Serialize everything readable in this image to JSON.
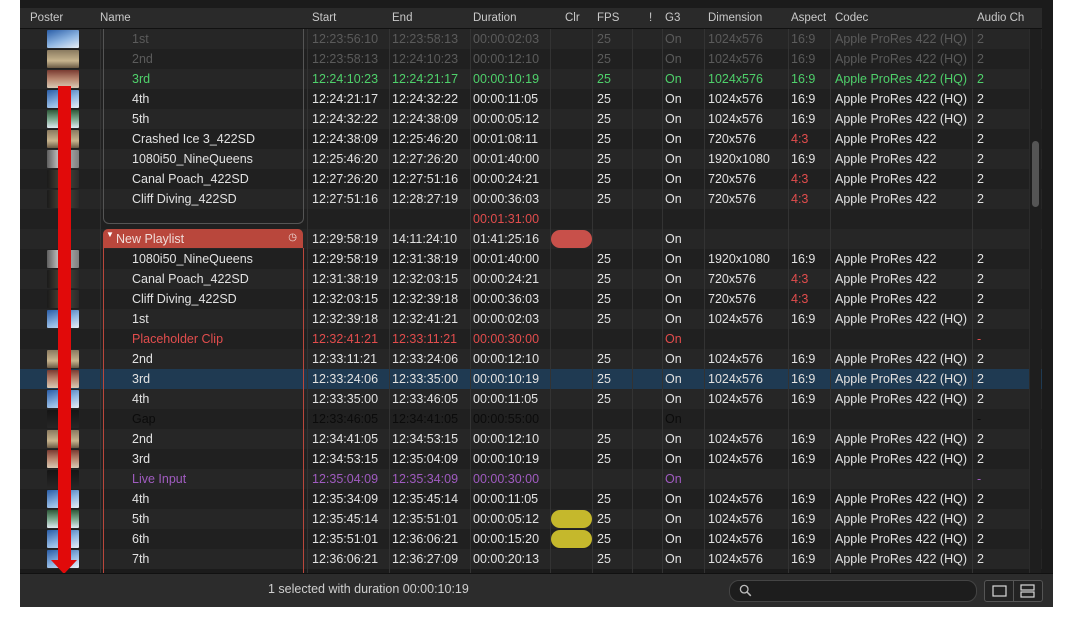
{
  "columns": [
    {
      "key": "poster",
      "label": "Poster"
    },
    {
      "key": "name",
      "label": "Name"
    },
    {
      "key": "start",
      "label": "Start"
    },
    {
      "key": "end",
      "label": "End"
    },
    {
      "key": "duration",
      "label": "Duration"
    },
    {
      "key": "clr",
      "label": "Clr"
    },
    {
      "key": "fps",
      "label": "FPS"
    },
    {
      "key": "bang",
      "label": "!"
    },
    {
      "key": "g3",
      "label": "G3"
    },
    {
      "key": "dimension",
      "label": "Dimension"
    },
    {
      "key": "aspect",
      "label": "Aspect"
    },
    {
      "key": "codec",
      "label": "Codec"
    },
    {
      "key": "audio",
      "label": "Audio Ch"
    }
  ],
  "colors": {
    "selected": "#1f3a52",
    "green": "#4fd16b",
    "red": "#e14d4d",
    "purple": "#a05cc0",
    "playlist": "#b9473c",
    "pill_yellow": "#c5b82c",
    "arrow": "#e10a0a"
  },
  "rows": [
    {
      "poster": "blue",
      "name": "1st",
      "start": "12:23:56:10",
      "end": "12:23:58:13",
      "duration": "00:00:02:03",
      "fps": "25",
      "g3": "On",
      "dimension": "1024x576",
      "aspect": "16:9",
      "codec": "Apple ProRes 422 (HQ)",
      "audio": "2",
      "style": "dim"
    },
    {
      "poster": "tan",
      "name": "2nd",
      "start": "12:23:58:13",
      "end": "12:24:10:23",
      "duration": "00:00:12:10",
      "fps": "25",
      "g3": "On",
      "dimension": "1024x576",
      "aspect": "16:9",
      "codec": "Apple ProRes 422 (HQ)",
      "audio": "2",
      "style": "dim"
    },
    {
      "poster": "brown",
      "name": "3rd",
      "start": "12:24:10:23",
      "end": "12:24:21:17",
      "duration": "00:00:10:19",
      "fps": "25",
      "g3": "On",
      "dimension": "1024x576",
      "aspect": "16:9",
      "codec": "Apple ProRes 422 (HQ)",
      "audio": "2",
      "style": "green"
    },
    {
      "poster": "blue",
      "name": "4th",
      "start": "12:24:21:17",
      "end": "12:24:32:22",
      "duration": "00:00:11:05",
      "fps": "25",
      "g3": "On",
      "dimension": "1024x576",
      "aspect": "16:9",
      "codec": "Apple ProRes 422 (HQ)",
      "audio": "2"
    },
    {
      "poster": "green",
      "name": "5th",
      "start": "12:24:32:22",
      "end": "12:24:38:09",
      "duration": "00:00:05:12",
      "fps": "25",
      "g3": "On",
      "dimension": "1024x576",
      "aspect": "16:9",
      "codec": "Apple ProRes 422 (HQ)",
      "audio": "2"
    },
    {
      "poster": "tan",
      "name": "Crashed Ice 3_422SD",
      "start": "12:24:38:09",
      "end": "12:25:46:20",
      "duration": "00:01:08:11",
      "fps": "25",
      "g3": "On",
      "dimension": "720x576",
      "aspect": "4:3",
      "codec": "Apple ProRes 422",
      "audio": "2",
      "aspect_red": true
    },
    {
      "poster": "gray",
      "name": "1080i50_NineQueens",
      "start": "12:25:46:20",
      "end": "12:27:26:20",
      "duration": "00:01:40:00",
      "fps": "25",
      "g3": "On",
      "dimension": "1920x1080",
      "aspect": "16:9",
      "codec": "Apple ProRes 422",
      "audio": "2"
    },
    {
      "poster": "dark",
      "name": "Canal Poach_422SD",
      "start": "12:27:26:20",
      "end": "12:27:51:16",
      "duration": "00:00:24:21",
      "fps": "25",
      "g3": "On",
      "dimension": "720x576",
      "aspect": "4:3",
      "codec": "Apple ProRes 422",
      "audio": "2",
      "aspect_red": true
    },
    {
      "poster": "dark",
      "name": "Cliff Diving_422SD",
      "start": "12:27:51:16",
      "end": "12:28:27:19",
      "duration": "00:00:36:03",
      "fps": "25",
      "g3": "On",
      "dimension": "720x576",
      "aspect": "4:3",
      "codec": "Apple ProRes 422",
      "audio": "2",
      "aspect_red": true
    },
    {
      "poster": "",
      "name": "",
      "start": "",
      "end": "",
      "duration": "00:01:31:00",
      "fps": "",
      "g3": "",
      "dimension": "",
      "aspect": "",
      "codec": "",
      "audio": "",
      "duration_red": true
    },
    {
      "poster": "",
      "name": "New Playlist",
      "start": "12:29:58:19",
      "end": "14:11:24:10",
      "duration": "01:41:25:16",
      "fps": "",
      "g3": "On",
      "dimension": "",
      "aspect": "",
      "codec": "",
      "audio": "",
      "playlist": true,
      "pill": "red"
    },
    {
      "poster": "gray",
      "name": "1080i50_NineQueens",
      "start": "12:29:58:19",
      "end": "12:31:38:19",
      "duration": "00:01:40:00",
      "fps": "25",
      "g3": "On",
      "dimension": "1920x1080",
      "aspect": "16:9",
      "codec": "Apple ProRes 422",
      "audio": "2"
    },
    {
      "poster": "dark",
      "name": "Canal Poach_422SD",
      "start": "12:31:38:19",
      "end": "12:32:03:15",
      "duration": "00:00:24:21",
      "fps": "25",
      "g3": "On",
      "dimension": "720x576",
      "aspect": "4:3",
      "codec": "Apple ProRes 422",
      "audio": "2",
      "aspect_red": true
    },
    {
      "poster": "dark",
      "name": "Cliff Diving_422SD",
      "start": "12:32:03:15",
      "end": "12:32:39:18",
      "duration": "00:00:36:03",
      "fps": "25",
      "g3": "On",
      "dimension": "720x576",
      "aspect": "4:3",
      "codec": "Apple ProRes 422",
      "audio": "2",
      "aspect_red": true
    },
    {
      "poster": "blue",
      "name": "1st",
      "start": "12:32:39:18",
      "end": "12:32:41:21",
      "duration": "00:00:02:03",
      "fps": "25",
      "g3": "On",
      "dimension": "1024x576",
      "aspect": "16:9",
      "codec": "Apple ProRes 422 (HQ)",
      "audio": "2"
    },
    {
      "poster": "",
      "name": "Placeholder Clip",
      "start": "12:32:41:21",
      "end": "12:33:11:21",
      "duration": "00:00:30:00",
      "fps": "",
      "g3": "On",
      "dimension": "",
      "aspect": "",
      "codec": "",
      "audio": "-",
      "style": "red"
    },
    {
      "poster": "tan",
      "name": "2nd",
      "start": "12:33:11:21",
      "end": "12:33:24:06",
      "duration": "00:00:12:10",
      "fps": "25",
      "g3": "On",
      "dimension": "1024x576",
      "aspect": "16:9",
      "codec": "Apple ProRes 422 (HQ)",
      "audio": "2"
    },
    {
      "poster": "brown",
      "name": "3rd",
      "start": "12:33:24:06",
      "end": "12:33:35:00",
      "duration": "00:00:10:19",
      "fps": "25",
      "g3": "On",
      "dimension": "1024x576",
      "aspect": "16:9",
      "codec": "Apple ProRes 422 (HQ)",
      "audio": "2",
      "selected": true
    },
    {
      "poster": "blue",
      "name": "4th",
      "start": "12:33:35:00",
      "end": "12:33:46:05",
      "duration": "00:00:11:05",
      "fps": "25",
      "g3": "On",
      "dimension": "1024x576",
      "aspect": "16:9",
      "codec": "Apple ProRes 422 (HQ)",
      "audio": "2"
    },
    {
      "poster": "black",
      "name": "Gap",
      "start": "12:33:46:05",
      "end": "12:34:41:05",
      "duration": "00:00:55:00",
      "fps": "",
      "g3": "On",
      "dimension": "",
      "aspect": "",
      "codec": "",
      "audio": "-",
      "style": "dark"
    },
    {
      "poster": "tan",
      "name": "2nd",
      "start": "12:34:41:05",
      "end": "12:34:53:15",
      "duration": "00:00:12:10",
      "fps": "25",
      "g3": "On",
      "dimension": "1024x576",
      "aspect": "16:9",
      "codec": "Apple ProRes 422 (HQ)",
      "audio": "2"
    },
    {
      "poster": "brown",
      "name": "3rd",
      "start": "12:34:53:15",
      "end": "12:35:04:09",
      "duration": "00:00:10:19",
      "fps": "25",
      "g3": "On",
      "dimension": "1024x576",
      "aspect": "16:9",
      "codec": "Apple ProRes 422 (HQ)",
      "audio": "2"
    },
    {
      "poster": "black",
      "name": "Live Input",
      "start": "12:35:04:09",
      "end": "12:35:34:09",
      "duration": "00:00:30:00",
      "fps": "",
      "g3": "On",
      "dimension": "",
      "aspect": "",
      "codec": "",
      "audio": "-",
      "style": "purple"
    },
    {
      "poster": "blue",
      "name": "4th",
      "start": "12:35:34:09",
      "end": "12:35:45:14",
      "duration": "00:00:11:05",
      "fps": "25",
      "g3": "On",
      "dimension": "1024x576",
      "aspect": "16:9",
      "codec": "Apple ProRes 422 (HQ)",
      "audio": "2"
    },
    {
      "poster": "green",
      "name": "5th",
      "start": "12:35:45:14",
      "end": "12:35:51:01",
      "duration": "00:00:05:12",
      "fps": "25",
      "g3": "On",
      "dimension": "1024x576",
      "aspect": "16:9",
      "codec": "Apple ProRes 422 (HQ)",
      "audio": "2",
      "pill": "yellow"
    },
    {
      "poster": "blue",
      "name": "6th",
      "start": "12:35:51:01",
      "end": "12:36:06:21",
      "duration": "00:00:15:20",
      "fps": "25",
      "g3": "On",
      "dimension": "1024x576",
      "aspect": "16:9",
      "codec": "Apple ProRes 422 (HQ)",
      "audio": "2",
      "pill": "yellow"
    },
    {
      "poster": "blue",
      "name": "7th",
      "start": "12:36:06:21",
      "end": "12:36:27:09",
      "duration": "00:00:20:13",
      "fps": "25",
      "g3": "On",
      "dimension": "1024x576",
      "aspect": "16:9",
      "codec": "Apple ProRes 422 (HQ)",
      "audio": "2"
    }
  ],
  "status": {
    "text": "1 selected with duration 00:00:10:19"
  },
  "search": {
    "placeholder": "",
    "value": ""
  },
  "icons": {
    "search": "search-icon",
    "playlist_toggle": "disclosure-triangle-icon",
    "playlist_clock": "clock-icon",
    "view_single": "single-view-icon",
    "view_list": "list-view-icon",
    "arrow": "red-down-arrow-icon"
  }
}
